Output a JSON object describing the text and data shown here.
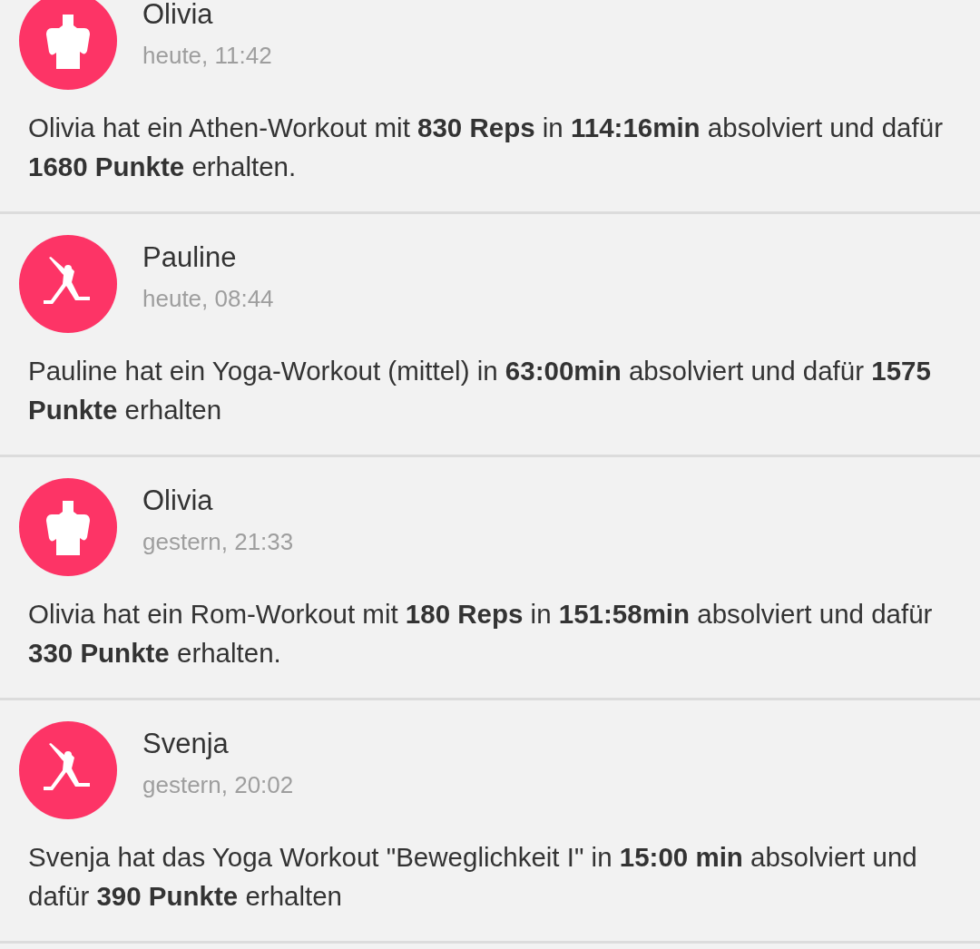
{
  "feed": [
    {
      "name": "Olivia",
      "time": "heute, 11:42",
      "kind": "torso",
      "text": "Olivia hat ein Athen-Workout mit **830 Reps** in **114:16min** absolviert und dafür **1680 Punkte** erhalten."
    },
    {
      "name": "Pauline",
      "time": "heute, 08:44",
      "kind": "yoga",
      "text": "Pauline hat ein Yoga-Workout (mittel) in **63:00min** absolviert und dafür **1575 Punkte** erhalten"
    },
    {
      "name": "Olivia",
      "time": "gestern, 21:33",
      "kind": "torso",
      "text": "Olivia hat ein Rom-Workout mit **180 Reps** in **151:58min** absolviert und dafür **330 Punkte** erhalten."
    },
    {
      "name": "Svenja",
      "time": "gestern, 20:02",
      "kind": "yoga",
      "text": "Svenja hat das Yoga Workout \"Beweglichkeit I\" in **15:00 min** absolviert und dafür **390 Punkte** erhalten"
    }
  ]
}
